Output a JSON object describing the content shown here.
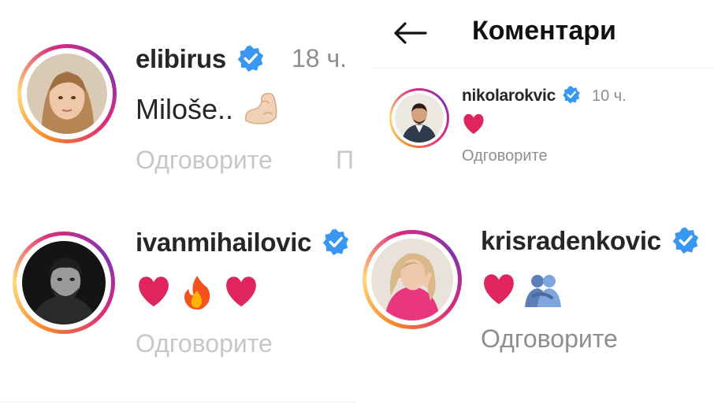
{
  "screen": {
    "header": {
      "title": "Коментари",
      "back_icon": "arrow-left-icon"
    },
    "comments": [
      {
        "username": "elibirus",
        "verified": true,
        "time": "18 ч.",
        "text": "Miloše..",
        "emoji": [
          "flexed-biceps-icon"
        ],
        "reply": "Одговорите",
        "extra_action": "П"
      },
      {
        "username": "nikolarokvic",
        "verified": true,
        "time": "10 ч.",
        "emoji": [
          "red-heart-icon"
        ],
        "reply": "Одговорите"
      },
      {
        "username": "ivanmihailovic",
        "verified": true,
        "emoji": [
          "red-heart-icon",
          "fire-icon",
          "red-heart-icon"
        ],
        "reply": "Одговорите"
      },
      {
        "username": "krisradenkovic",
        "verified": true,
        "emoji": [
          "red-heart-icon",
          "people-hugging-icon"
        ],
        "reply": "Одговорите"
      }
    ],
    "colors": {
      "verified_blue": "#3897f0",
      "muted_text": "#8e8e8e",
      "faded_text": "#c7c7c7",
      "heart_red": "#e0245e"
    }
  }
}
